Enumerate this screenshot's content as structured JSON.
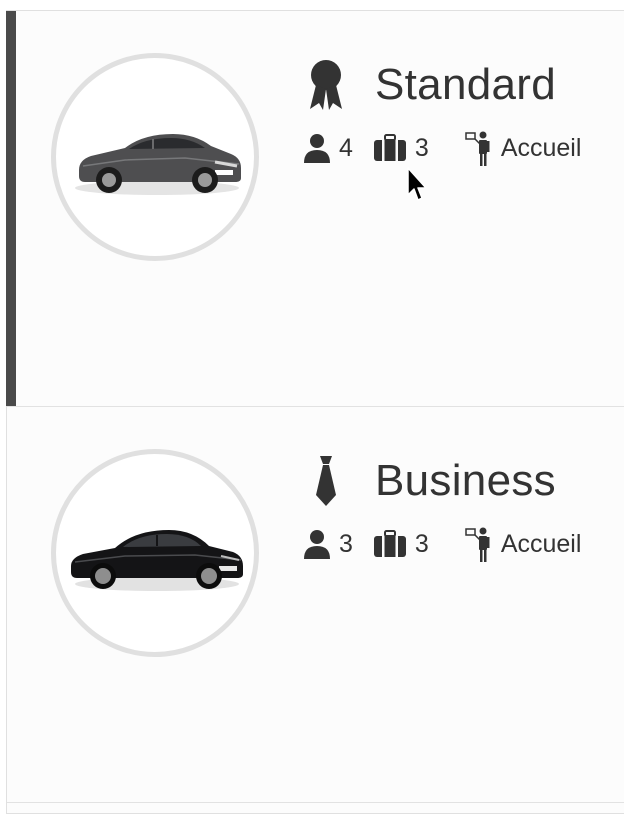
{
  "vehicles": [
    {
      "name": "Standard",
      "class_icon": "award-ribbon-icon",
      "image": "grey-hybrid-sedan-image",
      "passengers": "4",
      "luggage": "3",
      "service": "Accueil",
      "selected": true
    },
    {
      "name": "Business",
      "class_icon": "necktie-icon",
      "image": "black-executive-sedan-image",
      "passengers": "3",
      "luggage": "3",
      "service": "Accueil",
      "selected": false
    }
  ],
  "colors": {
    "text": "#333333",
    "selection_bar": "#4a4a4a",
    "circle_border": "#e0e0e0"
  }
}
